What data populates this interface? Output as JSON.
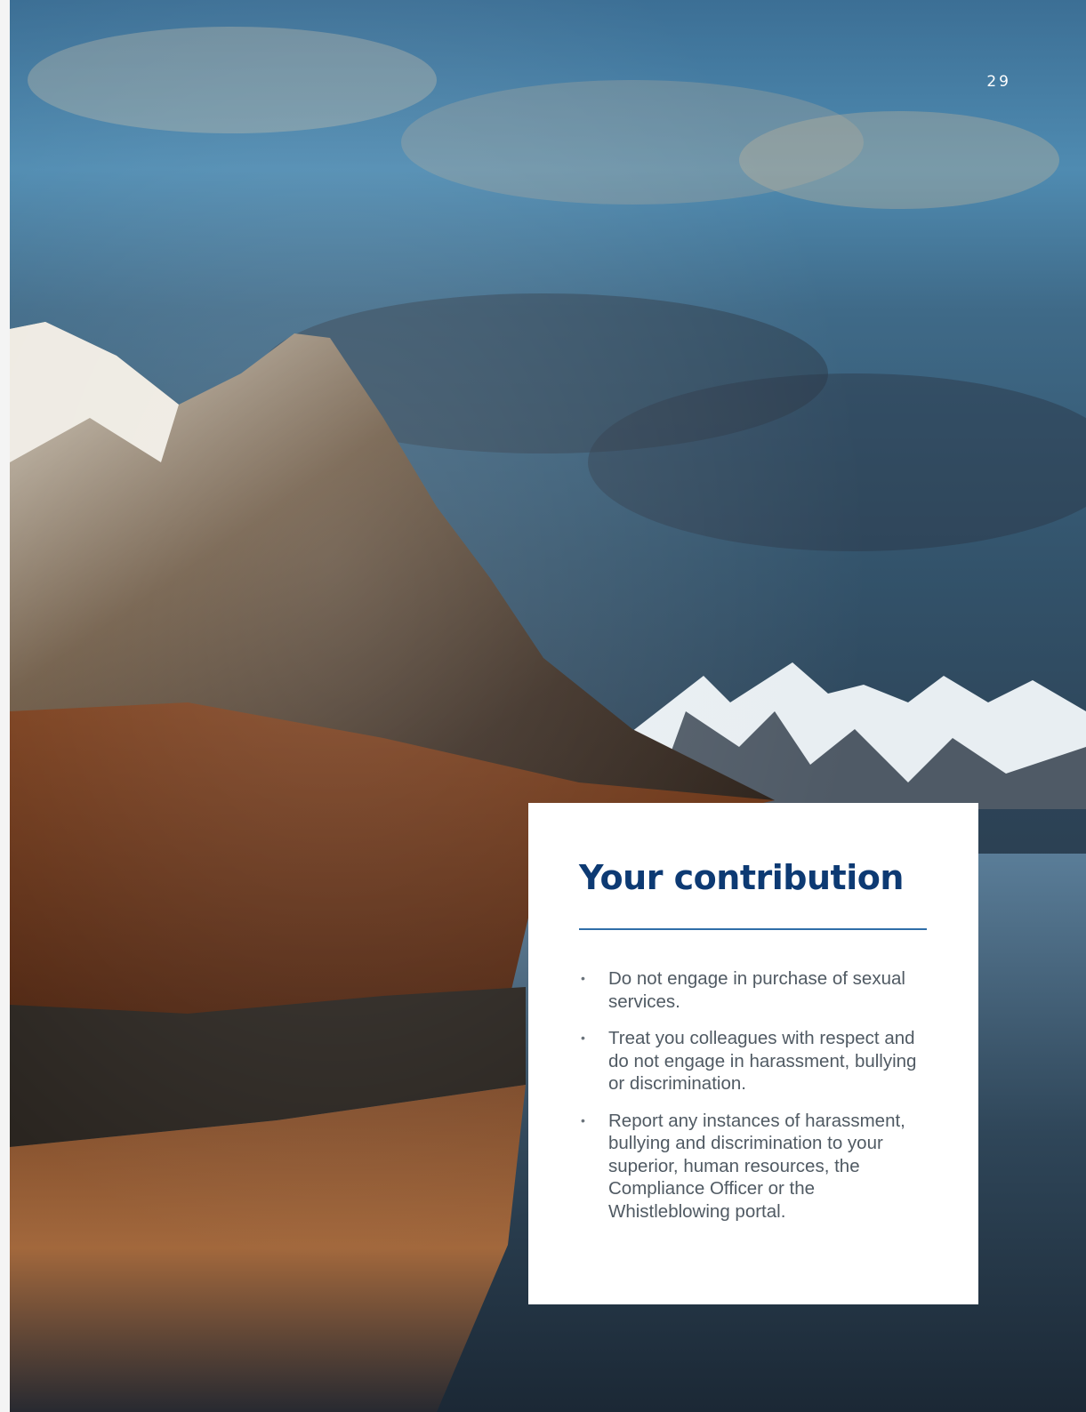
{
  "page": {
    "number": "29"
  },
  "photo": {
    "description_icon": "landscape-photo"
  },
  "card": {
    "title": "Your contribution",
    "bullets": [
      "Do not engage in purchase of sexual services.",
      "Treat you colleagues with respect and do not engage in harassment, bullying or discrimination.",
      "Report any instances of harassment, bullying and discrimination to your superior, human resources, the Compliance Officer or the Whistleblowing portal."
    ]
  },
  "colors": {
    "title": "#0d3a73",
    "rule": "#2f6ea8",
    "body_text": "#505a63"
  }
}
